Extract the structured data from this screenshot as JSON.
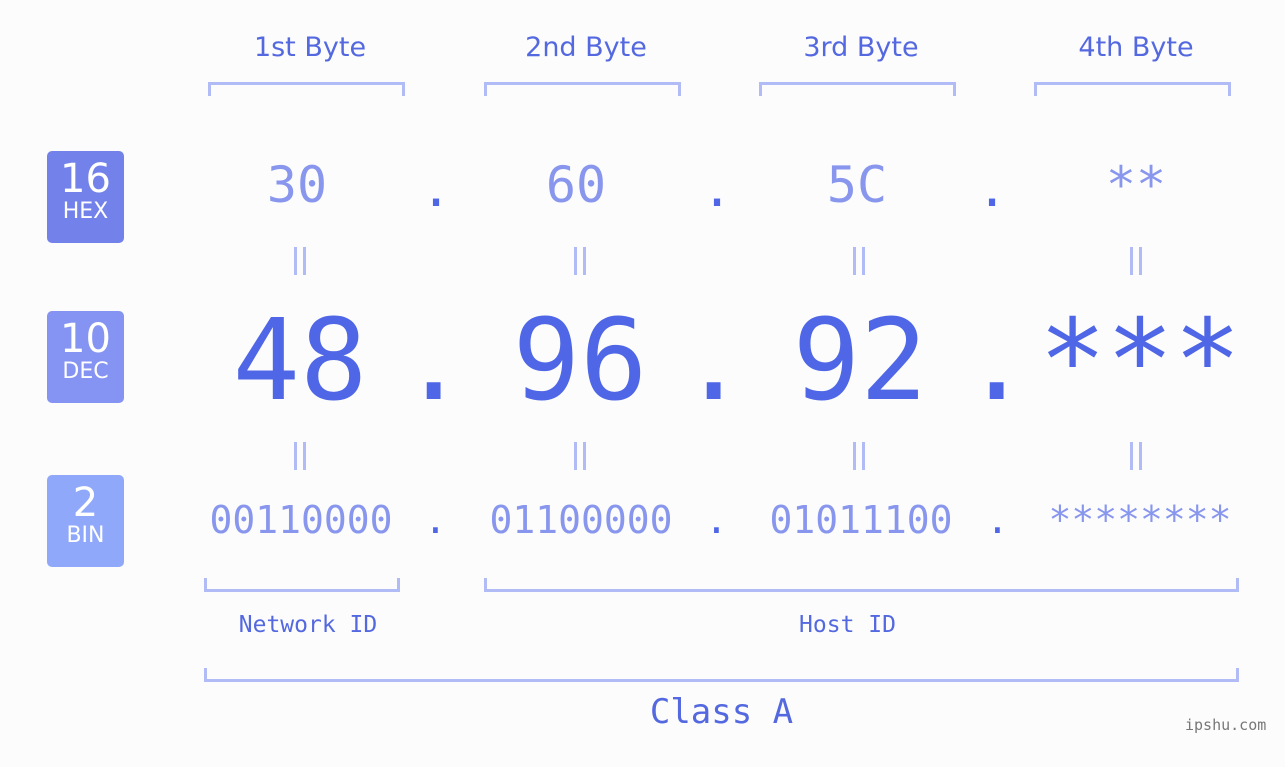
{
  "byte_headers": [
    "1st Byte",
    "2nd Byte",
    "3rd Byte",
    "4th Byte"
  ],
  "badges": {
    "hex": {
      "num": "16",
      "label": "HEX",
      "color": "#7382eb"
    },
    "dec": {
      "num": "10",
      "label": "DEC",
      "color": "#8593f2"
    },
    "bin": {
      "num": "2",
      "label": "BIN",
      "color": "#8fa8fa"
    }
  },
  "hex": [
    "30",
    "60",
    "5C",
    "**"
  ],
  "dec": [
    "48",
    "96",
    "92",
    "***"
  ],
  "bin": [
    "00110000",
    "01100000",
    "01011100",
    "********"
  ],
  "separator": ".",
  "labels": {
    "network_id": "Network ID",
    "host_id": "Host ID",
    "ip_class": "Class A"
  },
  "watermark": "ipshu.com"
}
